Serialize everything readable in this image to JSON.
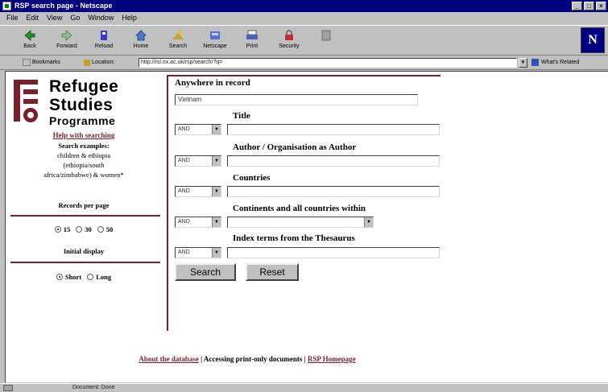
{
  "window": {
    "title": "RSP search page - Netscape"
  },
  "menu": [
    "File",
    "Edit",
    "View",
    "Go",
    "Window",
    "Help"
  ],
  "toolbar": [
    {
      "label": "Back",
      "icon": "back-arrow-icon"
    },
    {
      "label": "Forward",
      "icon": "forward-arrow-icon"
    },
    {
      "label": "Reload",
      "icon": "reload-icon"
    },
    {
      "label": "Home",
      "icon": "home-icon"
    },
    {
      "label": "Search",
      "icon": "search-icon"
    },
    {
      "label": "Netscape",
      "icon": "netscape-icon"
    },
    {
      "label": "Print",
      "icon": "print-icon"
    },
    {
      "label": "Security",
      "icon": "security-icon"
    },
    {
      "label": "",
      "icon": "stop-icon"
    }
  ],
  "location": {
    "bookmarks_label": "Bookmarks",
    "location_label": "Location:",
    "url": "http://rsl.ox.ac.uk/rsp/search/?q=",
    "whats_related": "What's Related"
  },
  "logo": {
    "line1": "Refugee",
    "line2": "Studies",
    "line3": "Programme"
  },
  "sidebar": {
    "help_link": "Help with searching",
    "examples_heading": "Search examples:",
    "example_line1": "children & ethiopia",
    "example_line2": "(ethiopia/south",
    "example_line3": "africa/zimbabwe) & women*",
    "records_label": "Records per page",
    "records_options": [
      "15",
      "30",
      "50"
    ],
    "records_selected": "15",
    "initial_display_label": "Initial display",
    "display_options": [
      "Short",
      "Long"
    ],
    "display_selected": "Short"
  },
  "form": {
    "anywhere_label": "Anywhere in record",
    "anywhere_value": "Vietnam",
    "title_label": "Title",
    "author_label": "Author / Organisation as Author",
    "countries_label": "Countries",
    "continents_label": "Continents and all countries within",
    "index_label": "Index terms from the Thesaurus",
    "operator_default": "AND",
    "search_button": "Search",
    "reset_button": "Reset"
  },
  "footer": {
    "about_link": "About the database",
    "separator": " | ",
    "accessing_text": "Accessing print-only documents",
    "rsp_link": "RSP Homepage"
  },
  "status": {
    "text": "Document: Done"
  },
  "colors": {
    "title_bar": "#000080",
    "brand_maroon": "#7a1f2b",
    "window_gray": "#c0c0c0"
  }
}
